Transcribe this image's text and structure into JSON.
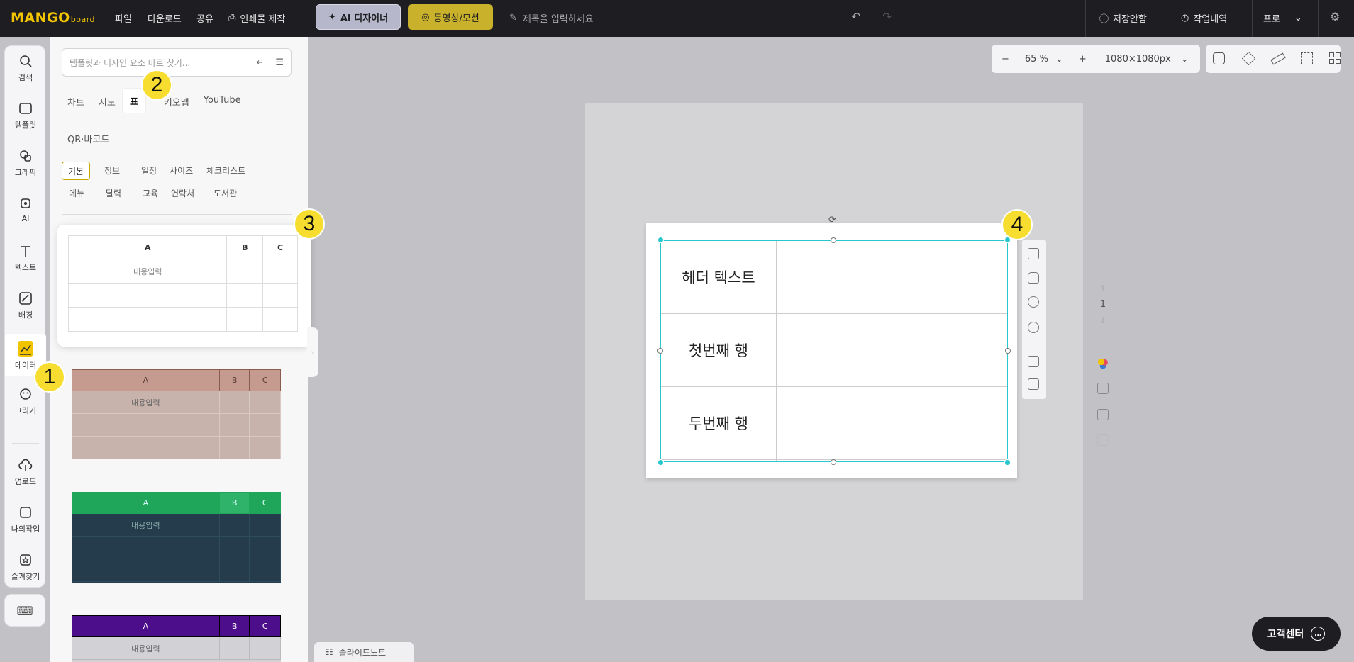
{
  "topbar": {
    "logo_main": "MANGO",
    "logo_sub": "board",
    "menu": [
      "파일",
      "다운로드",
      "공유"
    ],
    "print_label": "인쇄물 제작",
    "ai_designer_label": "AI 디자이너",
    "video_label": "동영상/모션",
    "title_placeholder": "제목을 입력하세요",
    "save_status": "저장안함",
    "history_label": "작업내역",
    "plan_label": "프로"
  },
  "leftnav": {
    "items": [
      "검색",
      "템플릿",
      "그래픽",
      "AI",
      "텍스트",
      "배경",
      "데이터",
      "그리기"
    ],
    "bottom_items": [
      "업로드",
      "나의작업",
      "즐겨찾기"
    ]
  },
  "panel": {
    "search_placeholder": "템플릿과 디자인 요소 바로 찾기...",
    "tabs": [
      "차트",
      "지도",
      "표",
      "키오맵",
      "YouTube"
    ],
    "active_tab": "표",
    "tab_qr": "QR·바코드",
    "chips_row1": [
      "기본",
      "정보",
      "일정",
      "사이즈",
      "체크리스트"
    ],
    "chips_row2": [
      "메뉴",
      "달력",
      "교육",
      "연락처",
      "도서관"
    ],
    "active_chip": "기본",
    "thumb_headers": [
      "A",
      "B",
      "C"
    ],
    "thumb_placeholder": "내용입력"
  },
  "canvas": {
    "zoom": "65 %",
    "size": "1080×1080px",
    "table_rows": [
      "헤더 텍스트",
      "첫번째 행",
      "두번째 행",
      ""
    ],
    "page_number": "1"
  },
  "footer": {
    "slide_note": "슬라이드노트",
    "support": "고객센터"
  },
  "callouts": [
    "1",
    "2",
    "3",
    "4"
  ],
  "colors": {
    "accent_yellow": "#f2c400",
    "selection_cyan": "#29c7cc",
    "thumb_brown": "#c49b8e",
    "thumb_green": "#1fa65a",
    "thumb_navy": "#253c4c",
    "thumb_purple": "#4c0e8a"
  }
}
